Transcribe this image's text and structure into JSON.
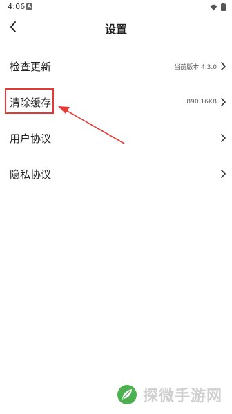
{
  "status_bar": {
    "time": "4:06",
    "notification_badge": "A",
    "icons": [
      "wifi-icon",
      "battery-icon"
    ]
  },
  "header": {
    "title": "设置",
    "back_icon": "chevron-left-icon"
  },
  "settings": [
    {
      "label": "检查更新",
      "value": "当前版本 4.3.0"
    },
    {
      "label": "清除缓存",
      "value": "890.16KB"
    },
    {
      "label": "用户协议",
      "value": ""
    },
    {
      "label": "隐私协议",
      "value": ""
    }
  ],
  "annotation": {
    "highlighted_item": "清除缓存",
    "color": "#e53935"
  },
  "watermark": {
    "text": "探微手游网"
  },
  "colors": {
    "background": "#ffffff",
    "text": "#222222",
    "secondary_text": "#555555",
    "annotation_red": "#e53935",
    "watermark_green": "#4caf50"
  }
}
